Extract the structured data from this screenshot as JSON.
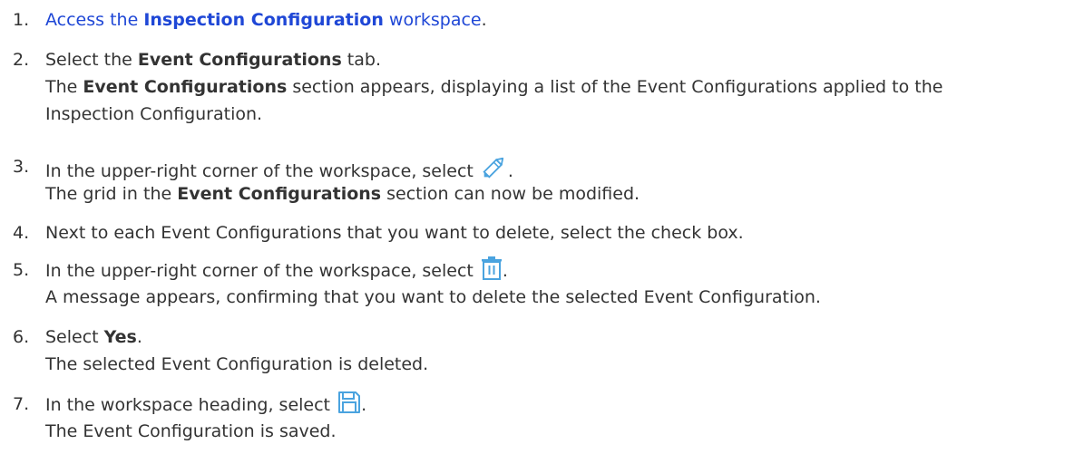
{
  "steps": [
    {
      "number": "1.",
      "link_prefix": "Access the ",
      "link_bold": "Inspection Configuration",
      "link_suffix": " workspace",
      "after": "."
    },
    {
      "number": "2.",
      "pre": "Select the ",
      "bold": "Event Configurations",
      "post": " tab.",
      "result_bold": "Event Configurations",
      "result_post": " section appears, displaying a list of the Event Configurations applied to the",
      "result_line2": "Inspection Configuration.",
      "result_pre": "The "
    },
    {
      "number": "3.",
      "pre": "In the upper-right corner of the workspace, select ",
      "icon": "pencil-icon",
      "post": ".",
      "result_pre": "The grid in the ",
      "result_bold": "Event Configurations",
      "result_post": " section can now be modified."
    },
    {
      "number": "4.",
      "text": "Next to each Event Configurations that you want to delete, select the check box."
    },
    {
      "number": "5.",
      "pre": "In the upper-right corner of the workspace, select ",
      "icon": "trash-icon",
      "post": ".",
      "result": "A message appears, confirming that you want to delete the selected Event Configuration."
    },
    {
      "number": "6.",
      "pre": "Select ",
      "bold": "Yes",
      "post": ".",
      "result": "The selected Event Configuration is deleted."
    },
    {
      "number": "7.",
      "pre": "In the workspace heading, select ",
      "icon": "save-icon",
      "post": ".",
      "result": "The Event Configuration is saved."
    }
  ],
  "colors": {
    "text": "#333333",
    "link": "#1f47d6",
    "icon": "#4aa3df"
  }
}
